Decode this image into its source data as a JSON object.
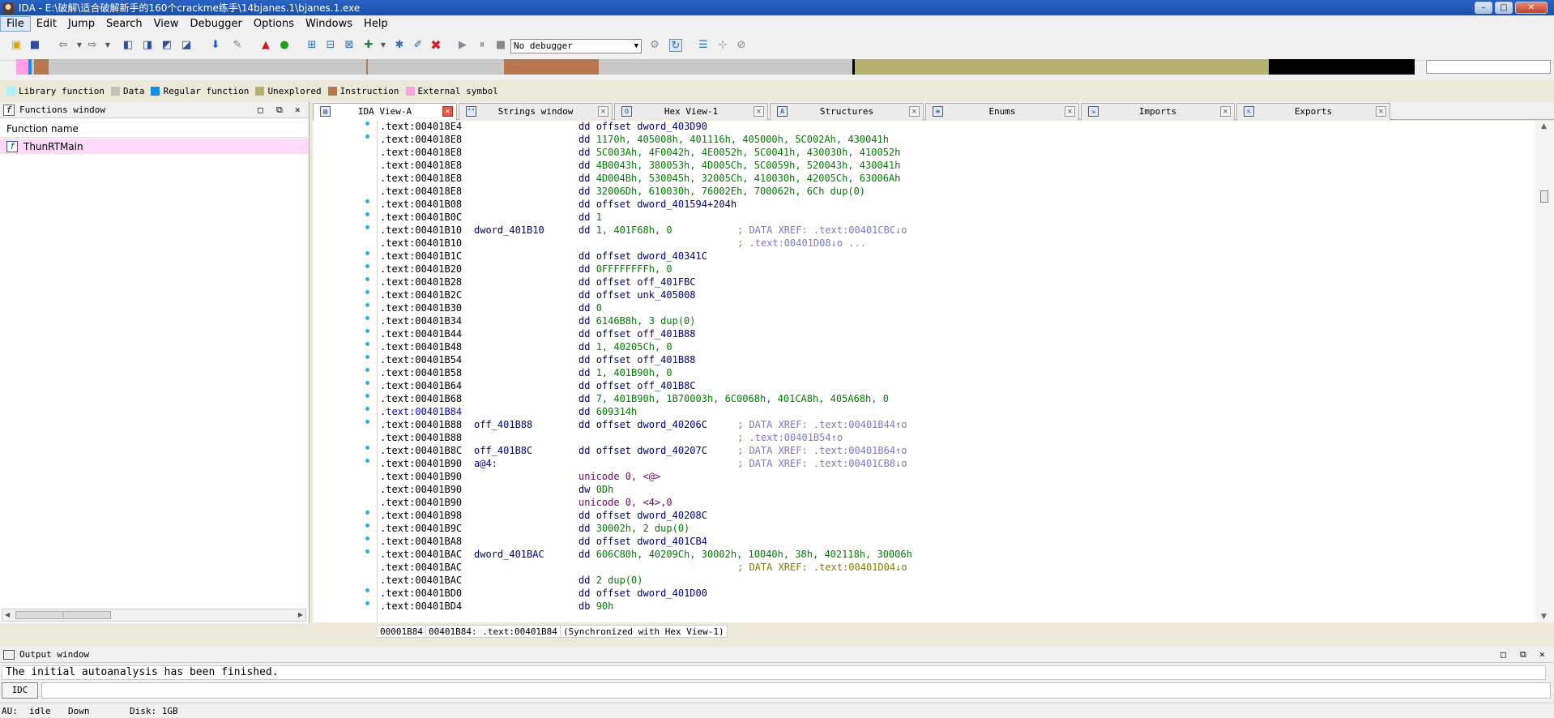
{
  "window": {
    "title": "IDA - E:\\破解\\适合破解新手的160个crackme练手\\14bjanes.1\\bjanes.1.exe"
  },
  "menu": [
    "File",
    "Edit",
    "Jump",
    "Search",
    "View",
    "Debugger",
    "Options",
    "Windows",
    "Help"
  ],
  "toolbar": {
    "debugger_select": "No debugger"
  },
  "legend": [
    {
      "label": "Library function",
      "color": "#aaf4ff"
    },
    {
      "label": "Data",
      "color": "#c0c0c0"
    },
    {
      "label": "Regular function",
      "color": "#0b8ff0"
    },
    {
      "label": "Unexplored",
      "color": "#b5b06d"
    },
    {
      "label": "Instruction",
      "color": "#b7784f"
    },
    {
      "label": "External symbol",
      "color": "#ffa0e6"
    }
  ],
  "functions_window": {
    "title": "Functions window",
    "column": "Function name",
    "items": [
      "ThunRTMain"
    ]
  },
  "tabs": [
    {
      "label": "IDA View-A",
      "active": true
    },
    {
      "label": "Strings window"
    },
    {
      "label": "Hex View-1"
    },
    {
      "label": "Structures"
    },
    {
      "label": "Enums"
    },
    {
      "label": "Imports"
    },
    {
      "label": "Exports"
    }
  ],
  "disassembly": [
    {
      "addr": ".text:004018E4",
      "op": "dd offset dword_403D90",
      "dot": true
    },
    {
      "addr": ".text:004018E8",
      "op": "dd 1170h, 405008h, 401116h, 405000h, 5C002Ah, 430041h",
      "dot": true
    },
    {
      "addr": ".text:004018E8",
      "op": "dd 5C003Ah, 4F0042h, 4E0052h, 5C0041h, 430030h, 410052h"
    },
    {
      "addr": ".text:004018E8",
      "op": "dd 4B0043h, 380053h, 4D005Ch, 5C0059h, 520043h, 430041h"
    },
    {
      "addr": ".text:004018E8",
      "op": "dd 4D004Bh, 530045h, 32005Ch, 410030h, 42005Ch, 63006Ah"
    },
    {
      "addr": ".text:004018E8",
      "op": "dd 32006Dh, 610030h, 76002Eh, 700062h, 6Ch dup(0)"
    },
    {
      "addr": ".text:00401B08",
      "op": "dd offset dword_401594+204h",
      "dot": true
    },
    {
      "addr": ".text:00401B0C",
      "op": "dd 1",
      "dot": true
    },
    {
      "addr": ".text:00401B10",
      "label": "dword_401B10",
      "op": "dd 1, 401F68h, 0",
      "comment": "; DATA XREF: .text:00401CBC↓o",
      "dot": true
    },
    {
      "addr": ".text:00401B10",
      "comment": "; .text:00401D08↓o ..."
    },
    {
      "addr": ".text:00401B1C",
      "op": "dd offset dword_40341C",
      "dot": true
    },
    {
      "addr": ".text:00401B20",
      "op": "dd 0FFFFFFFFh, 0",
      "dot": true
    },
    {
      "addr": ".text:00401B28",
      "op": "dd offset off_401FBC",
      "dot": true
    },
    {
      "addr": ".text:00401B2C",
      "op": "dd offset unk_405008",
      "dot": true
    },
    {
      "addr": ".text:00401B30",
      "op": "dd 0",
      "dot": true
    },
    {
      "addr": ".text:00401B34",
      "op": "dd 6146B8h, 3 dup(0)",
      "dot": true
    },
    {
      "addr": ".text:00401B44",
      "op": "dd offset off_401B88",
      "dot": true
    },
    {
      "addr": ".text:00401B48",
      "op": "dd 1, 40205Ch, 0",
      "dot": true
    },
    {
      "addr": ".text:00401B54",
      "op": "dd offset off_401B88",
      "dot": true
    },
    {
      "addr": ".text:00401B58",
      "op": "dd 1, 401B90h, 0",
      "dot": true
    },
    {
      "addr": ".text:00401B64",
      "op": "dd offset off_401B8C",
      "dot": true
    },
    {
      "addr": ".text:00401B68",
      "op": "dd 7, 401B90h, 1B70003h, 6C0068h, 401CA8h, 405A68h, 0",
      "dot": true
    },
    {
      "addr": ".text:00401B84",
      "op": "dd 609314h",
      "selected": true,
      "dot": true
    },
    {
      "addr": ".text:00401B88",
      "label": "off_401B88",
      "op": "dd offset dword_40206C",
      "comment": "; DATA XREF: .text:00401B44↑o",
      "dot": true
    },
    {
      "addr": ".text:00401B88",
      "comment": "; .text:00401B54↑o"
    },
    {
      "addr": ".text:00401B8C",
      "label": "off_401B8C",
      "op": "dd offset dword_40207C",
      "comment": "; DATA XREF: .text:00401B64↑o",
      "dot": true
    },
    {
      "addr": ".text:00401B90",
      "label": "a@4:",
      "comment": "; DATA XREF: .text:00401CB8↓o",
      "dot": true
    },
    {
      "addr": ".text:00401B90",
      "op": "unicode 0, <@>",
      "unicode": true
    },
    {
      "addr": ".text:00401B90",
      "op": "dw 0Dh"
    },
    {
      "addr": ".text:00401B90",
      "op": "unicode 0, <4>,0",
      "unicode": true
    },
    {
      "addr": ".text:00401B98",
      "op": "dd offset dword_40208C",
      "dot": true
    },
    {
      "addr": ".text:00401B9C",
      "op": "dd 30002h, 2 dup(0)",
      "dot": true
    },
    {
      "addr": ".text:00401BA8",
      "op": "dd offset dword_401CB4",
      "dot": true
    },
    {
      "addr": ".text:00401BAC",
      "label": "dword_401BAC",
      "op": "dd 606C80h, 40209Ch, 30002h, 10040h, 38h, 402118h, 30006h",
      "dot": true
    },
    {
      "addr": ".text:00401BAC",
      "comment": "; DATA XREF: .text:00401D04↓o",
      "yellow": true
    },
    {
      "addr": ".text:00401BAC",
      "op": "dd 2 dup(0)"
    },
    {
      "addr": ".text:00401BD0",
      "op": "dd offset dword_401D00",
      "dot": true
    },
    {
      "addr": ".text:00401BD4",
      "op": "db 90h",
      "dot": true
    }
  ],
  "view_status": [
    "00001B84",
    "00401B84: .text:00401B84",
    "(Synchronized with Hex View-1)"
  ],
  "output_window": {
    "title": "Output window",
    "text": "The initial autoanalysis has been finished.",
    "idc_label": "IDC"
  },
  "statusbar": {
    "au": "AU:",
    "state": "idle",
    "direction": "Down",
    "disk": "Disk: 1GB"
  },
  "colors": {
    "titlebar": "#1c4fa6",
    "selected_function": "#ffd9f7",
    "address_selected": "#0000ff"
  }
}
